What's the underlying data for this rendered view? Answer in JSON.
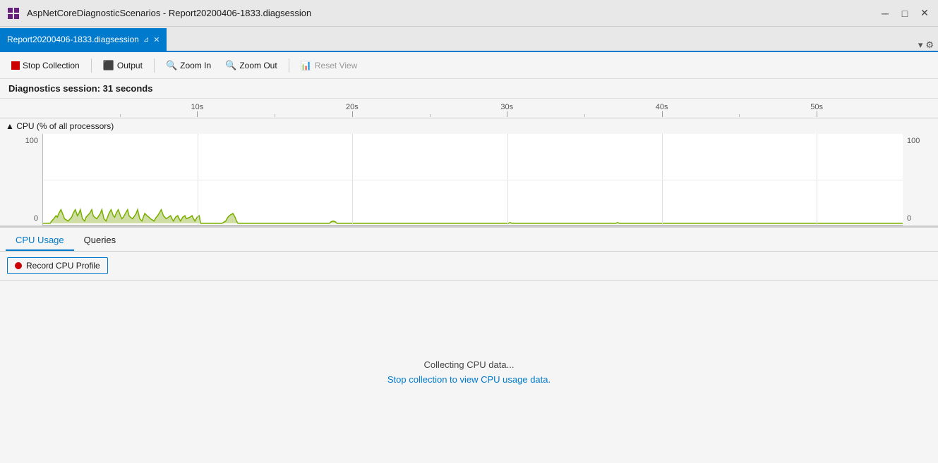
{
  "titleBar": {
    "icon": "vs-icon",
    "title": "AspNetCoreDiagnosticScenarios - Report20200406-1833.diagsession",
    "minimizeLabel": "─",
    "maximizeLabel": "□",
    "closeLabel": "✕"
  },
  "tabBar": {
    "tabLabel": "Report20200406-1833.diagsession",
    "pinLabel": "⊿",
    "closeLabel": "✕"
  },
  "toolbar": {
    "stopCollectionLabel": "Stop Collection",
    "outputLabel": "Output",
    "zoomInLabel": "Zoom In",
    "zoomOutLabel": "Zoom Out",
    "resetViewLabel": "Reset View"
  },
  "sessionInfo": {
    "label": "Diagnostics session: 31 seconds"
  },
  "timeline": {
    "ticks": [
      "10s",
      "20s",
      "30s",
      "40s",
      "50s"
    ],
    "tickPositions": [
      18,
      36,
      54,
      72,
      90
    ]
  },
  "cpuChart": {
    "headerLabel": "▲ CPU (% of all processors)",
    "yMax": "100",
    "yMin": "0",
    "yMaxRight": "100",
    "yMinRight": "0"
  },
  "bottomTabs": {
    "tabs": [
      "CPU Usage",
      "Queries"
    ],
    "activeTab": "CPU Usage"
  },
  "recordBtn": {
    "label": "Record CPU Profile"
  },
  "centerMessage": {
    "line1": "Collecting CPU data...",
    "line2": "Stop collection to view CPU usage data."
  }
}
